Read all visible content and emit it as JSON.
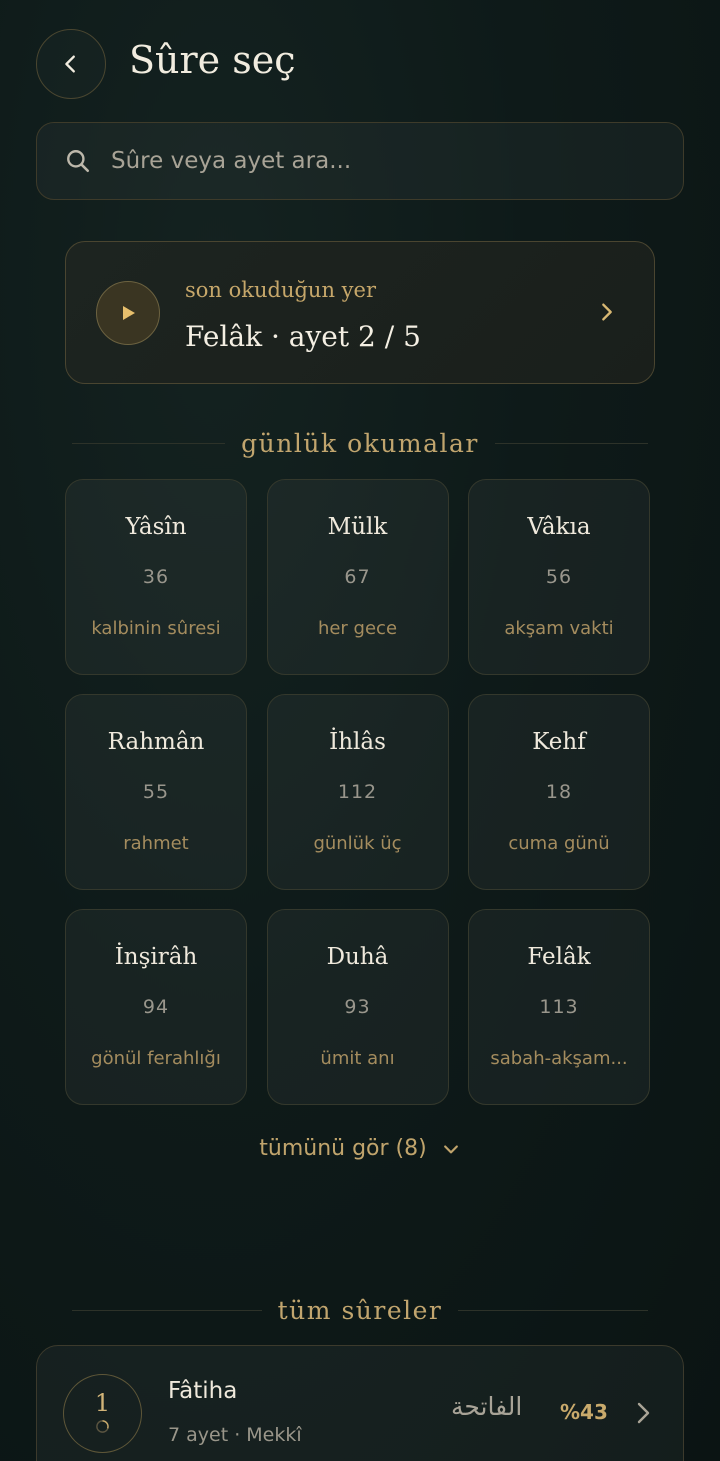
{
  "header": {
    "title": "Sûre seç"
  },
  "search": {
    "placeholder": "Sûre veya ayet ara..."
  },
  "resume": {
    "label": "son okuduğun yer",
    "value": "Felâk · ayet 2 / 5"
  },
  "daily": {
    "title": "günlük okumalar",
    "items": [
      {
        "name": "Yâsîn",
        "number": "36",
        "note": "kalbinin sûresi"
      },
      {
        "name": "Mülk",
        "number": "67",
        "note": "her gece"
      },
      {
        "name": "Vâkıa",
        "number": "56",
        "note": "akşam vakti"
      },
      {
        "name": "Rahmân",
        "number": "55",
        "note": "rahmet"
      },
      {
        "name": "İhlâs",
        "number": "112",
        "note": "günlük üç"
      },
      {
        "name": "Kehf",
        "number": "18",
        "note": "cuma günü"
      },
      {
        "name": "İnşirâh",
        "number": "94",
        "note": "gönül ferahlığı"
      },
      {
        "name": "Duhâ",
        "number": "93",
        "note": "ümit anı"
      },
      {
        "name": "Felâk",
        "number": "113",
        "note": "sabah-akşam..."
      }
    ],
    "see_all": "tümünü gör (8)"
  },
  "all_surahs": {
    "title": "tüm sûreler",
    "items": [
      {
        "number": "1",
        "name": "Fâtiha",
        "meta": "7 ayet · Mekkî",
        "arabic": "الفاتحة",
        "progress": "%43"
      }
    ]
  },
  "colors": {
    "accent": "#c1a56e",
    "background": "#0e1a19"
  }
}
